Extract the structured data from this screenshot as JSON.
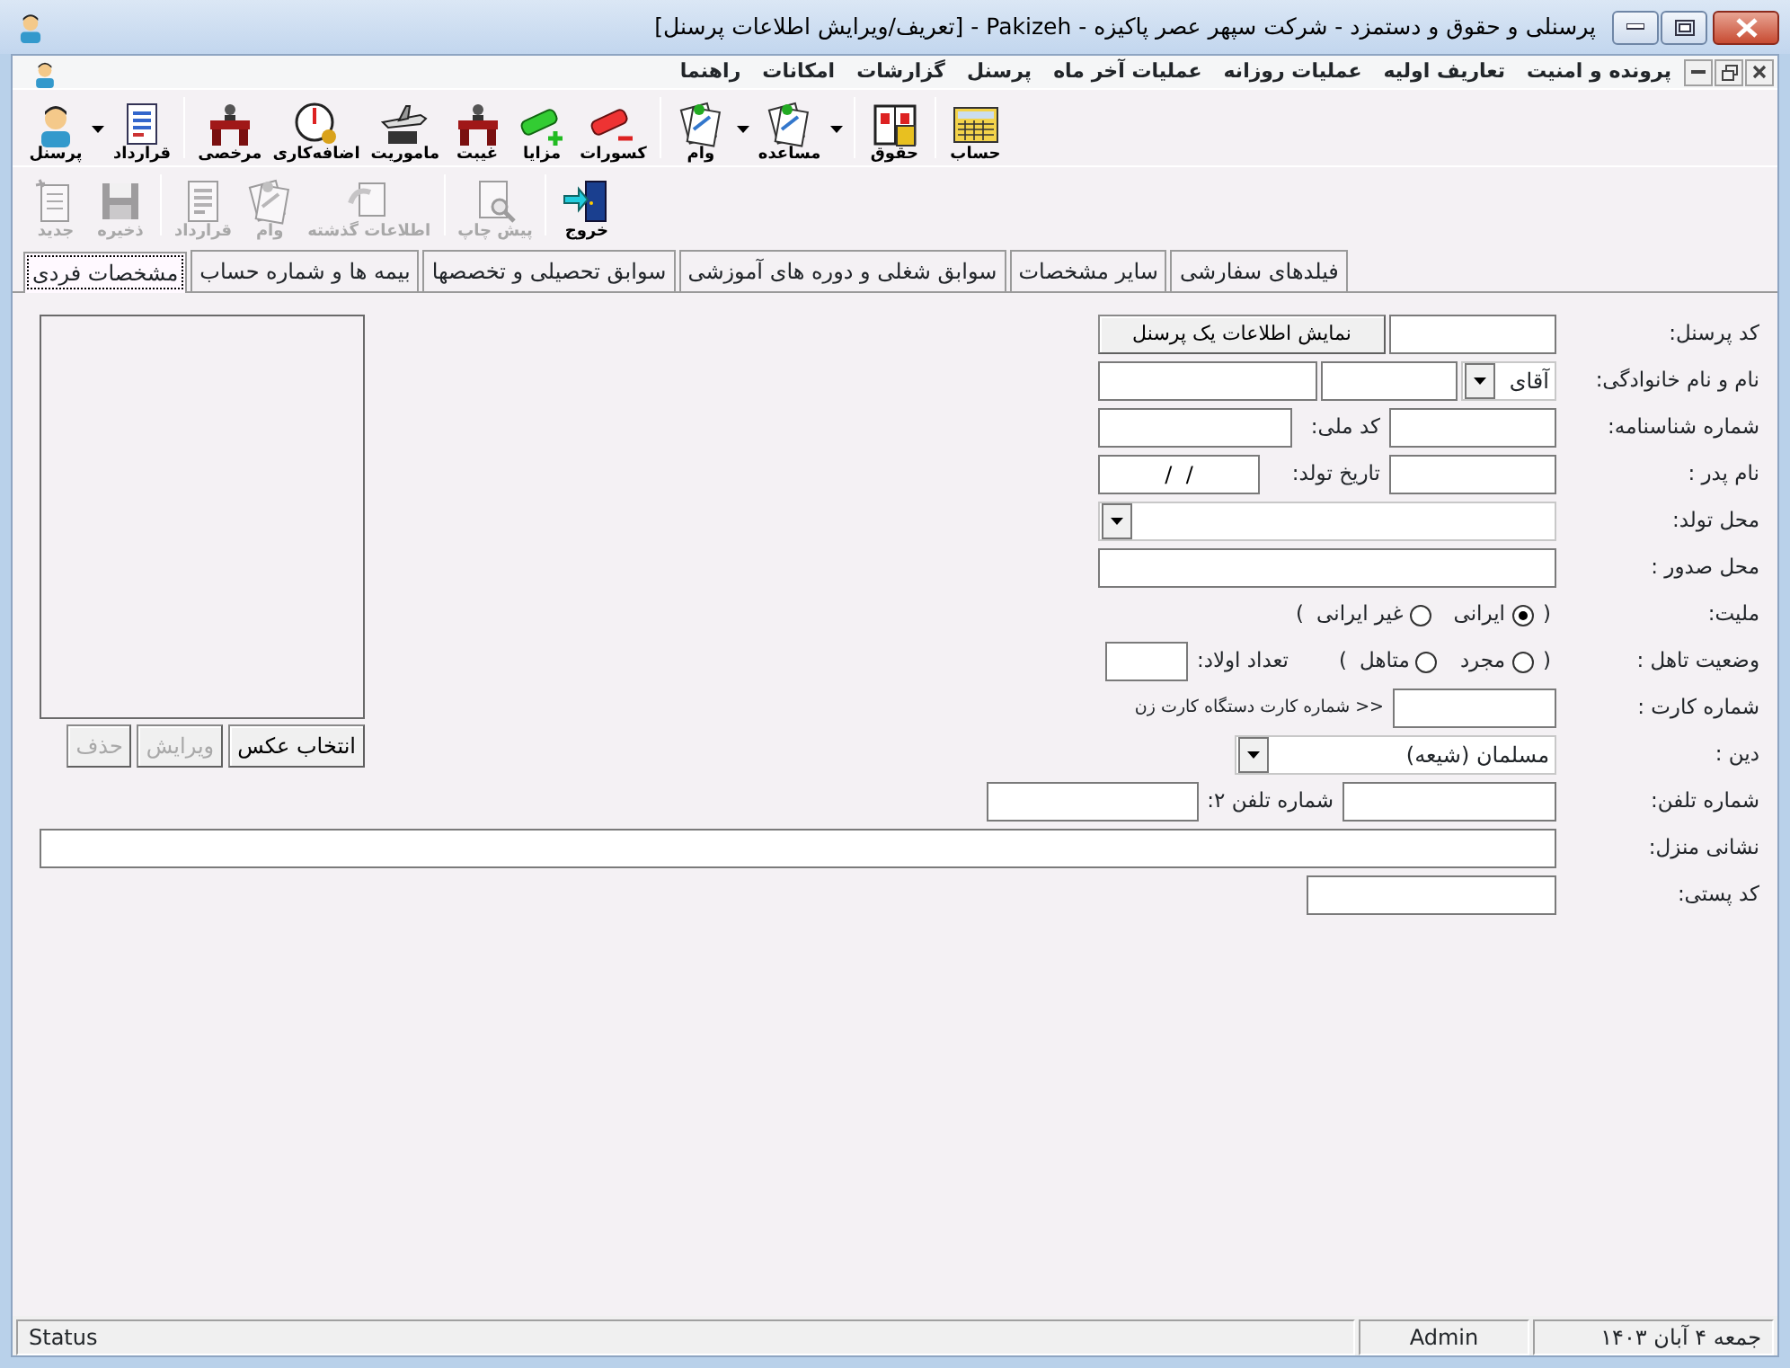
{
  "window": {
    "title": "پرسنلی و حقوق و دستمزد - شرکت سپهر عصر پاکیزه - Pakizeh - [تعریف/ویرایش اطلاعات پرسنل]"
  },
  "menu": [
    "پرونده و امنیت",
    "تعاریف اولیه",
    "عملیات روزانه",
    "عملیات آخر ماه",
    "پرسنل",
    "گزارشات",
    "امکانات",
    "راهنما"
  ],
  "toolbar": [
    [
      {
        "label": "حساب",
        "dropdown": false
      }
    ],
    [
      {
        "label": "حقوق",
        "dropdown": false
      }
    ],
    [
      {
        "label": "مساعده",
        "dropdown": true
      },
      {
        "label": "وام",
        "dropdown": true
      }
    ],
    [
      {
        "label": "کسورات",
        "dropdown": false
      },
      {
        "label": "مزایا",
        "dropdown": false
      },
      {
        "label": "غیبت",
        "dropdown": false
      },
      {
        "label": "ماموریت",
        "dropdown": false
      },
      {
        "label": "اضافه‌کاری",
        "dropdown": false
      },
      {
        "label": "مرخصی",
        "dropdown": false
      }
    ],
    [
      {
        "label": "قرارداد",
        "dropdown": false
      },
      {
        "label": "پرسنل",
        "dropdown": true
      }
    ]
  ],
  "actions": [
    [
      {
        "label": "خروج",
        "disabled": false
      }
    ],
    [
      {
        "label": "پیش چاپ",
        "disabled": true
      }
    ],
    [
      {
        "label": "اطلاعات گذشته",
        "disabled": true
      },
      {
        "label": "وام",
        "disabled": true
      },
      {
        "label": "قرارداد",
        "disabled": true
      }
    ],
    [
      {
        "label": "ذخیره",
        "disabled": true
      },
      {
        "label": "جدید",
        "disabled": true
      }
    ]
  ],
  "tabs": [
    {
      "label": "فیلدهای سفارشی",
      "selected": false
    },
    {
      "label": "سایر مشخصات",
      "selected": false
    },
    {
      "label": "سوابق شغلی و دوره های آموزشی",
      "selected": false
    },
    {
      "label": "سوابق تحصیلی و تخصصها",
      "selected": false
    },
    {
      "label": "بیمه ها و شماره حساب",
      "selected": false
    },
    {
      "label": "مشخصات فردی",
      "selected": true
    }
  ],
  "form": {
    "personnel_code": {
      "label": "کد پرسنل:",
      "button": "نمایش اطلاعات یک پرسنل"
    },
    "full_name": {
      "label": "نام و نام خانوادگی:",
      "title_value": "آقای"
    },
    "id_number": {
      "label": "شماره شناسنامه:",
      "national_code_label": "کد ملی:"
    },
    "father_name": {
      "label": "نام پدر :",
      "birth_date_label": "تاریخ تولد:",
      "birth_date_value": "/  /"
    },
    "birth_place": {
      "label": "محل تولد:"
    },
    "issue_place": {
      "label": "محل صدور :"
    },
    "nationality": {
      "label": "ملیت:",
      "open": "(",
      "close": ")",
      "options": [
        {
          "label": "ایرانی",
          "selected": true
        },
        {
          "label": "غیر ایرانی",
          "selected": false
        }
      ]
    },
    "marital": {
      "label": "وضعیت تاهل :",
      "open": "(",
      "close": ")",
      "options": [
        {
          "label": "مجرد",
          "selected": false
        },
        {
          "label": "متاهل",
          "selected": false
        }
      ],
      "children_label": "تعداد اولاد:"
    },
    "card_number": {
      "label": "شماره کارت :",
      "hint": "<< شماره کارت دستگاه کارت زن"
    },
    "religion": {
      "label": "دین :",
      "value": "مسلمان (شیعه)"
    },
    "phone": {
      "label": "شماره تلفن:",
      "phone2_label": "شماره تلفن ۲:"
    },
    "address": {
      "label": "نشانی منزل:"
    },
    "postal_code": {
      "label": "کد پستی:"
    }
  },
  "photo": {
    "buttons": [
      {
        "label": "انتخاب عکس",
        "disabled": false
      },
      {
        "label": "ویرایش",
        "disabled": true
      },
      {
        "label": "حذف",
        "disabled": true
      }
    ]
  },
  "status_bar": {
    "status": "Status",
    "user": "Admin",
    "date": "جمعه ۴ آبان ۱۴۰۳"
  }
}
